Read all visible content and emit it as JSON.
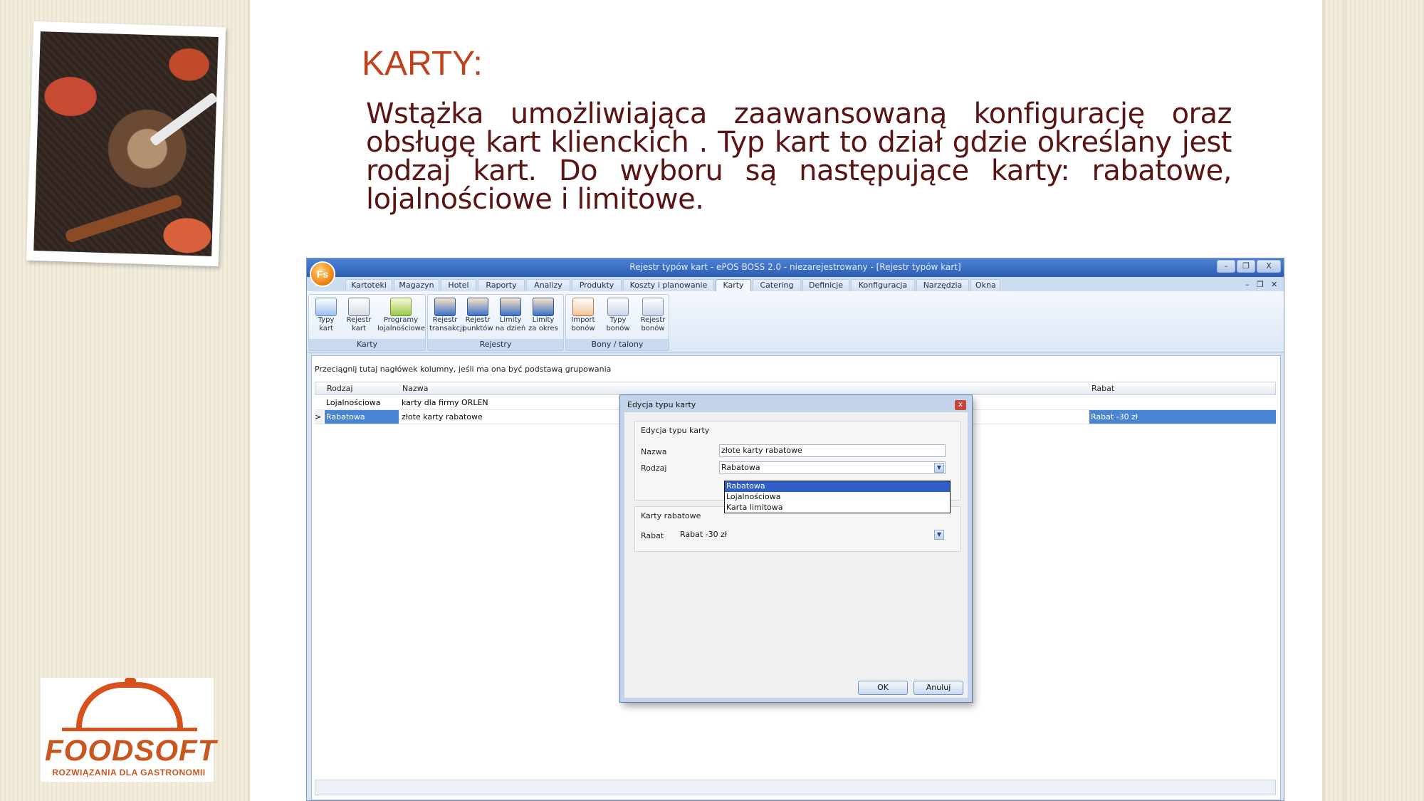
{
  "slide": {
    "title": "KARTY:",
    "body": "Wstążka umożliwiająca zaawansowaną konfigurację oraz obsługę kart klienckich . Typ kart to dział gdzie określany jest rodzaj kart. Do wyboru są następujące karty: rabatowe, lojalnościowe i limitowe."
  },
  "logo": {
    "name": "FOODSOFT",
    "tagline": "ROZWIĄZANIA DLA GASTRONOMII"
  },
  "window": {
    "title": "Rejestr typów kart - ePOS BOSS 2.0 - niezarejestrowany - [Rejestr typów kart]",
    "orb_label": "Fs",
    "controls": {
      "minimize": "–",
      "restore": "❐",
      "close": "X"
    },
    "mdi_controls": {
      "minimize": "–",
      "restore": "❐",
      "close": "✕"
    }
  },
  "tabs": [
    "Kartoteki",
    "Magazyn",
    "Hotel",
    "Raporty",
    "Analizy",
    "Produkty",
    "Koszty i planowanie",
    "Karty",
    "Catering",
    "Definicje",
    "Konfiguracja",
    "Narzędzia",
    "Okna"
  ],
  "active_tab": "Karty",
  "ribbon": {
    "groups": [
      {
        "label": "Karty",
        "buttons": [
          "Typy kart",
          "Rejestr kart",
          "Programy lojalnościowe"
        ]
      },
      {
        "label": "Rejestry",
        "buttons": [
          "Rejestr transakcji",
          "Rejestr punktów",
          "Limity na dzień",
          "Limity za okres"
        ]
      },
      {
        "label": "Bony / talony",
        "buttons": [
          "Import bonów",
          "Typy bonów",
          "Rejestr bonów"
        ]
      }
    ]
  },
  "grid": {
    "group_hint": "Przeciągnij tutaj nagłówek kolumny, jeśli ma ona być podstawą grupowania",
    "columns": [
      "Rodzaj",
      "Nazwa",
      "Rabat"
    ],
    "rows": [
      {
        "rodzaj": "Lojalnościowa",
        "nazwa": "karty dla firmy ORLEN",
        "rabat": ""
      },
      {
        "rodzaj": "Rabatowa",
        "nazwa": "złote karty rabatowe",
        "rabat": "Rabat -30 zł"
      }
    ],
    "selected_row_marker": ">"
  },
  "dialog": {
    "title": "Edycja typu karty",
    "close": "x",
    "section1_title": "Edycja typu karty",
    "name_label": "Nazwa",
    "name_value": "złote karty rabatowe",
    "type_label": "Rodzaj",
    "type_value": "Rabatowa",
    "dropdown_options": [
      "Rabatowa",
      "Lojalnościowa",
      "Karta limitowa"
    ],
    "dropdown_highlighted": "Rabatowa",
    "section2_title": "Karty rabatowe",
    "discount_label": "Rabat",
    "discount_value": "Rabat -30 zł",
    "ok": "OK",
    "cancel": "Anuluj"
  },
  "colors": {
    "title": "#c0411c",
    "body_text": "#5a1414",
    "logo": "#d8501c",
    "selection": "#4a85d3"
  },
  "icons": [
    "photo-food-image",
    "app-orb-icon",
    "cards-icon",
    "register-icon",
    "loyalty-icon",
    "transactions-icon",
    "points-icon",
    "limit-day-icon",
    "limit-period-icon",
    "import-icon",
    "voucher-types-icon",
    "voucher-register-icon",
    "dropdown-arrow-icon"
  ]
}
